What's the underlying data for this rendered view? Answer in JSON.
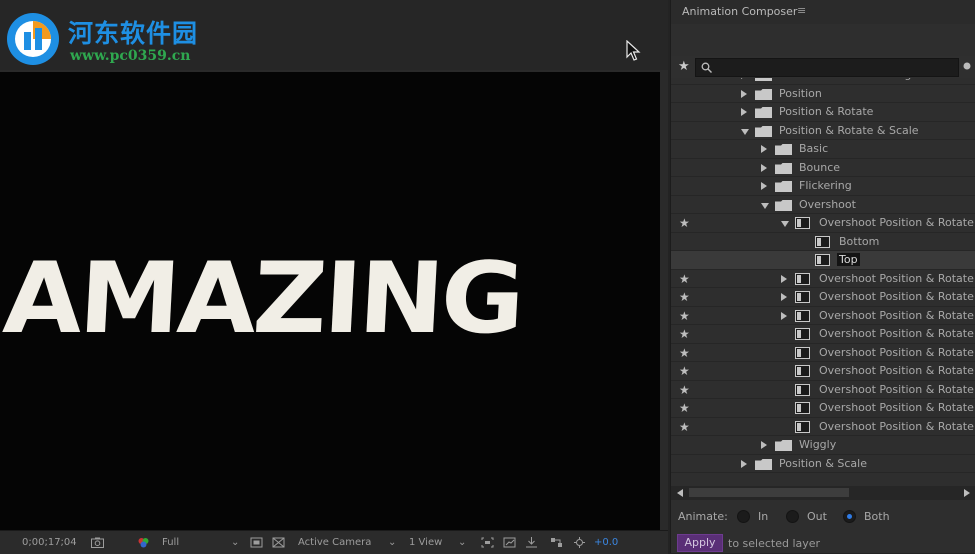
{
  "watermark": {
    "title": "河东软件园",
    "url": "www.pc0359.cn"
  },
  "viewer": {
    "text": "AMAZING",
    "text_color": "#f1eee6",
    "bottom": {
      "timecode": "0;00;17;04",
      "resolution": "Full",
      "camera": "Active Camera",
      "views": "1 View",
      "exposure": "+0.0"
    }
  },
  "panel": {
    "title": "Animation Composer",
    "menu": "≡",
    "favorite_icon": "★",
    "tree": [
      {
        "label": "Fade & Scale & Tracking",
        "type": "folder",
        "expander": "right",
        "star": false
      },
      {
        "label": "Position",
        "type": "folder",
        "expander": "right",
        "star": false
      },
      {
        "label": "Position & Rotate",
        "type": "folder",
        "expander": "right",
        "star": false
      },
      {
        "label": "Position & Rotate & Scale",
        "type": "folder",
        "expander": "down",
        "star": false
      },
      {
        "label": "Basic",
        "type": "folder",
        "expander": "right",
        "star": false
      },
      {
        "label": "Bounce",
        "type": "folder",
        "expander": "right",
        "star": false
      },
      {
        "label": "Flickering",
        "type": "folder",
        "expander": "right",
        "star": false
      },
      {
        "label": "Overshoot",
        "type": "folder",
        "expander": "down",
        "star": false
      },
      {
        "label": "Overshoot Position & Rotate",
        "type": "preset",
        "expander": "down",
        "star": true
      },
      {
        "label": "Bottom",
        "type": "preset",
        "expander": "none",
        "star": false
      },
      {
        "label": "Top",
        "type": "preset",
        "expander": "none",
        "star": false
      },
      {
        "label": "Overshoot Position & Rotate",
        "type": "preset",
        "expander": "right",
        "star": true
      },
      {
        "label": "Overshoot Position & Rotate",
        "type": "preset",
        "expander": "right",
        "star": true
      },
      {
        "label": "Overshoot Position & Rotate",
        "type": "preset",
        "expander": "right",
        "star": true
      },
      {
        "label": "Overshoot Position & Rotate",
        "type": "preset",
        "expander": "none",
        "star": true
      },
      {
        "label": "Overshoot Position & Rotate",
        "type": "preset",
        "expander": "none",
        "star": true
      },
      {
        "label": "Overshoot Position & Rotate",
        "type": "preset",
        "expander": "none",
        "star": true
      },
      {
        "label": "Overshoot Position & Rotate",
        "type": "preset",
        "expander": "none",
        "star": true
      },
      {
        "label": "Overshoot Position & Rotate",
        "type": "preset",
        "expander": "none",
        "star": true
      },
      {
        "label": "Overshoot Position & Rotate",
        "type": "preset",
        "expander": "none",
        "star": true
      },
      {
        "label": "Wiggly",
        "type": "folder",
        "expander": "right",
        "star": false
      },
      {
        "label": "Position & Scale",
        "type": "folder",
        "expander": "right",
        "star": false
      }
    ],
    "selected_item": "Top",
    "animate": {
      "label": "Animate:",
      "options": [
        "In",
        "Out",
        "Both"
      ],
      "selected": "Both"
    },
    "apply": {
      "button": "Apply",
      "hint": "to selected layer"
    },
    "accent_color": "#2f7be5",
    "apply_color": "#5a2f77"
  }
}
